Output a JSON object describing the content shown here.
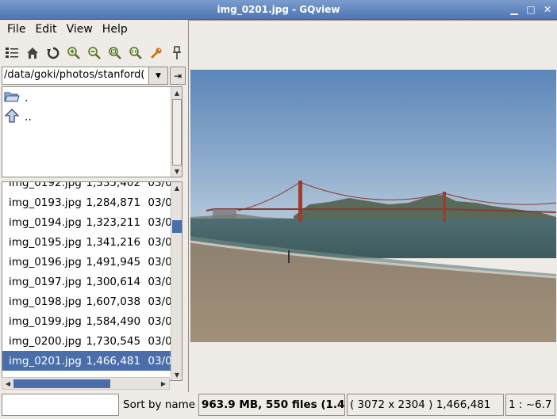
{
  "window": {
    "title": "img_0201.jpg - GQview"
  },
  "menu": {
    "file": "File",
    "edit": "Edit",
    "view": "View",
    "help": "Help"
  },
  "toolbar": {
    "icons": [
      "thumbnails-icon",
      "home-icon",
      "refresh-icon",
      "zoom-in-icon",
      "zoom-out-icon",
      "zoom-fit-icon",
      "zoom-1-1-icon",
      "configure-icon",
      "pin-icon"
    ]
  },
  "path": {
    "value": "/data/goki/photos/stanford("
  },
  "dirs": [
    {
      "label": ".",
      "icon": "folder-open-icon"
    },
    {
      "label": "..",
      "icon": "up-arrow-icon"
    }
  ],
  "files": [
    {
      "name": "img_0192.jpg",
      "size": "1,335,402",
      "date": "03/0"
    },
    {
      "name": "img_0193.jpg",
      "size": "1,284,871",
      "date": "03/0"
    },
    {
      "name": "img_0194.jpg",
      "size": "1,323,211",
      "date": "03/0"
    },
    {
      "name": "img_0195.jpg",
      "size": "1,341,216",
      "date": "03/0"
    },
    {
      "name": "img_0196.jpg",
      "size": "1,491,945",
      "date": "03/0"
    },
    {
      "name": "img_0197.jpg",
      "size": "1,300,614",
      "date": "03/0"
    },
    {
      "name": "img_0198.jpg",
      "size": "1,607,038",
      "date": "03/0"
    },
    {
      "name": "img_0199.jpg",
      "size": "1,584,490",
      "date": "03/0"
    },
    {
      "name": "img_0200.jpg",
      "size": "1,730,545",
      "date": "03/0"
    },
    {
      "name": "img_0201.jpg",
      "size": "1,466,481",
      "date": "03/0"
    }
  ],
  "status": {
    "input_value": "",
    "sort": "Sort by name",
    "summary": "963.9 MB, 550 files (1.4",
    "image_info": "( 3072 x 2304 ) 1,466,481",
    "zoom": "1 : ~6.7"
  },
  "colors": {
    "selection": "#4a6ea9",
    "titlebar": "#5b80bb"
  }
}
